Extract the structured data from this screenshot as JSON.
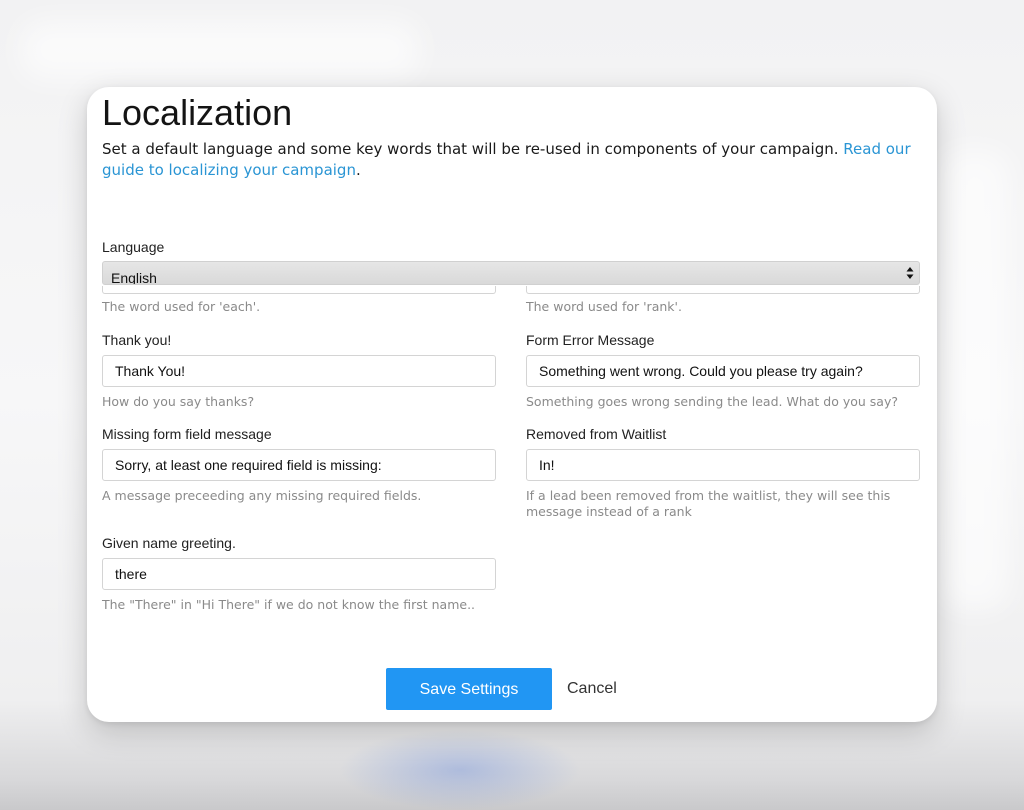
{
  "modal": {
    "title": "Localization",
    "description": "Set a default language and some key words that will be re-used in components of your campaign. ",
    "guide_link": "Read our guide to localizing your campaign",
    "description_end": "."
  },
  "language": {
    "label": "Language",
    "selected": "English"
  },
  "each_field": {
    "help": "The word used for 'each'."
  },
  "rank_field": {
    "help": "The word used for 'rank'."
  },
  "thank_you": {
    "label": "Thank you!",
    "value": "Thank You!",
    "help": "How do you say thanks?"
  },
  "form_error": {
    "label": "Form Error Message",
    "value": "Something went wrong. Could you please try again?",
    "help": "Something goes wrong sending the lead. What do you say?"
  },
  "missing_field": {
    "label": "Missing form field message",
    "value": "Sorry, at least one required field is missing:",
    "help": "A message preceeding any missing required fields."
  },
  "removed_waitlist": {
    "label": "Removed from Waitlist",
    "value": "In!",
    "help": "If a lead been removed from the waitlist, they will see this message instead of a rank"
  },
  "given_name": {
    "label": "Given name greeting.",
    "value": "there",
    "help": "The \"There\" in \"Hi There\" if we do not know the first name.."
  },
  "actions": {
    "save": "Save Settings",
    "cancel": "Cancel"
  },
  "colors": {
    "accent": "#2196f3",
    "link": "#2a95d4"
  }
}
